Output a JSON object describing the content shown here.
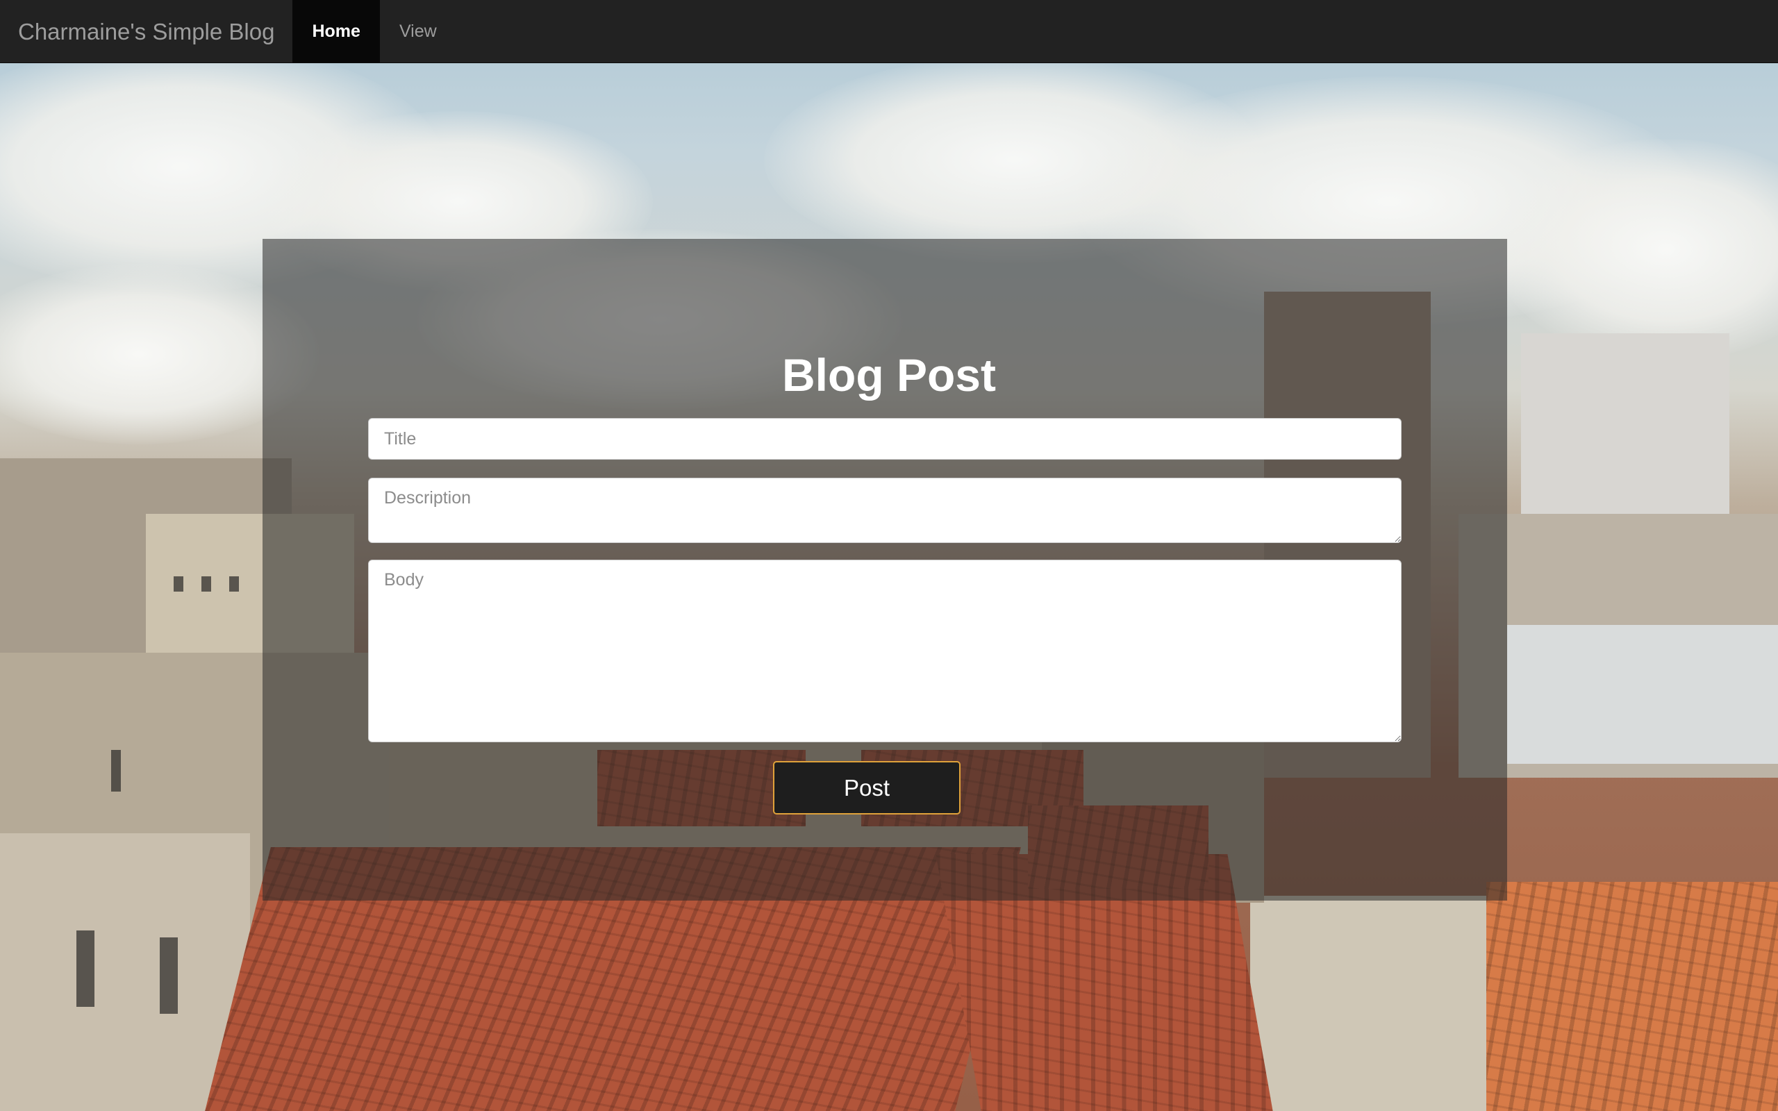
{
  "navbar": {
    "brand": "Charmaine's Simple Blog",
    "items": [
      {
        "label": "Home",
        "active": true
      },
      {
        "label": "View",
        "active": false
      }
    ]
  },
  "form": {
    "heading": "Blog Post",
    "title_placeholder": "Title",
    "description_placeholder": "Description",
    "body_placeholder": "Body",
    "submit_label": "Post"
  },
  "colors": {
    "navbar_bg": "#222222",
    "nav_active_bg": "#080808",
    "button_border": "#e0a23a"
  }
}
